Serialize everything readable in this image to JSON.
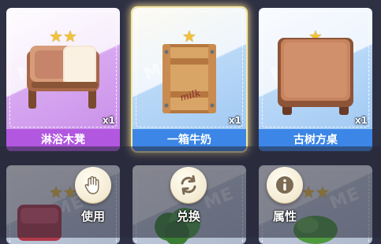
{
  "items": [
    {
      "name": "淋浴木凳",
      "qty": "x1",
      "stars": 2,
      "rarity_color": "#b257e0",
      "watermark": "MY"
    },
    {
      "name": "一箱牛奶",
      "qty": "x1",
      "stars": 1,
      "rarity_color": "#3b86e6",
      "watermark": "MY",
      "selected": true,
      "crate_text": "milk"
    },
    {
      "name": "古树方桌",
      "qty": "x1",
      "stars": 1,
      "rarity_color": "#3b86e6",
      "watermark": "MY"
    }
  ],
  "bottom_items": [
    {
      "stars": 2,
      "watermark": "ME"
    },
    {
      "stars": 2,
      "watermark": "ME"
    },
    {
      "stars": 2,
      "watermark": "ME"
    }
  ],
  "actions": [
    {
      "label": "使用",
      "icon": "hand-icon"
    },
    {
      "label": "兑换",
      "icon": "exchange-icon"
    },
    {
      "label": "属性",
      "icon": "info-icon"
    }
  ]
}
